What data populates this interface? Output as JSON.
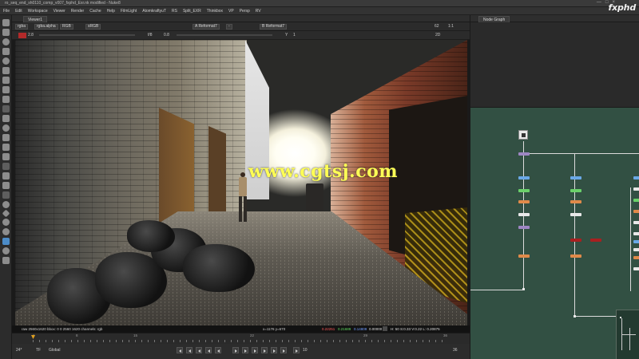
{
  "window": {
    "title": "ro_seq_end_sh0110_comp_v007_fxphd_Exr.nk modified - Nuke8",
    "controls": [
      "—",
      "□",
      "×"
    ]
  },
  "menu": [
    "File",
    "Edit",
    "Workspace",
    "Viewer",
    "Render",
    "Cache",
    "Help",
    "FilmLight",
    "AtomkraftyuT",
    "RS",
    "Split_EXR",
    "Thinkbox",
    "VP",
    "Persp",
    "RV"
  ],
  "brand": "fxphd",
  "viewer": {
    "tab_label": "Viewer1",
    "channels": "rgba",
    "alpha": "rgba.alpha",
    "colorspace": "RGB",
    "lut": "sRGB",
    "input_a": "A  Reformat7",
    "input_a_dash": "-",
    "input_b": "B  Reformat7",
    "zoom": "62",
    "ratio": "1:1",
    "mode": "2D",
    "fstop": "2.8",
    "gamma": "0.8",
    "gain_label": "f/8",
    "y_label": "Y",
    "gamma_val": "1"
  },
  "infobar": {
    "format": "raw 2560x1620  bbox: 0 0 2560 1620 channels: rgb",
    "coords": "x=1176 y=670",
    "r": "0.22251",
    "g": "0.21689",
    "b": "0.14809",
    "a": "0.00000",
    "hsv": "H: 50 S:0.33 V:0.22  L: 0.20875"
  },
  "timeline": {
    "ticks": [
      "1",
      "8",
      "15",
      "22",
      "29",
      "36"
    ],
    "current_frame": "24*",
    "tf": "TF",
    "range_mode": "Global",
    "fps": "10",
    "end_frame": "36"
  },
  "watermark_text": "www.cgtsj.com",
  "nodegraph": {
    "tab_label": "Node Graph"
  },
  "colors": {
    "node_graph_bg": "#325043",
    "node_purple": "#9d86c2",
    "node_blue": "#6aa8e6",
    "node_green": "#6ad06a",
    "node_orange": "#e08a4a",
    "node_white": "#e8e8e8",
    "node_red": "#a82020"
  }
}
